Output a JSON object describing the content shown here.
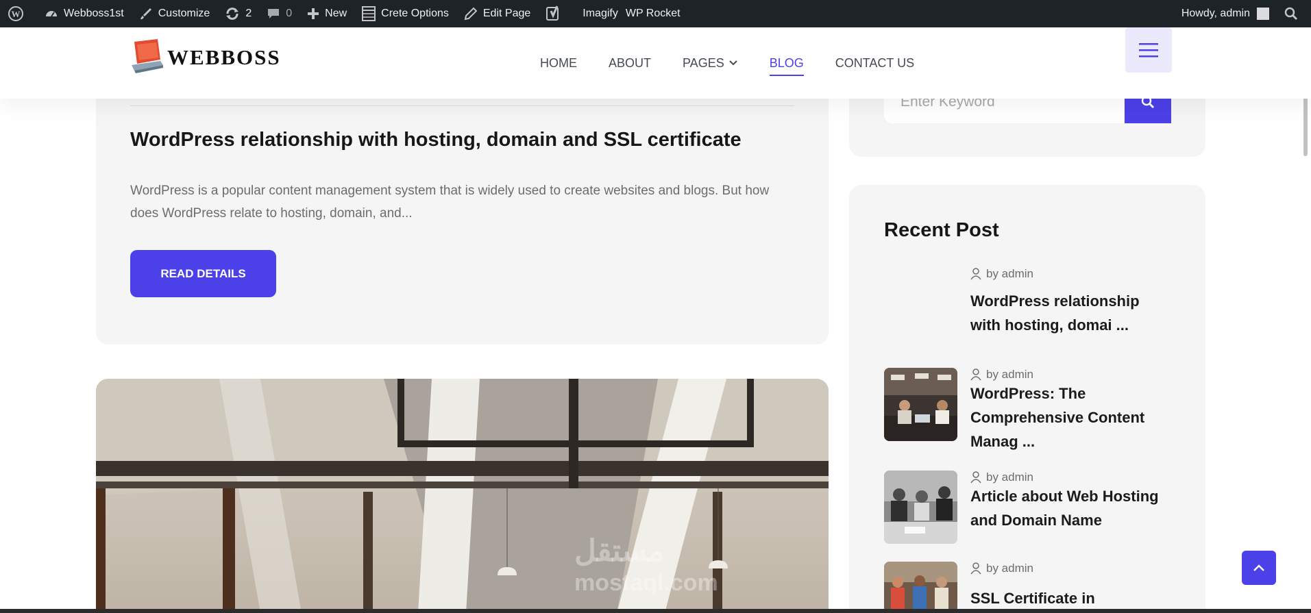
{
  "adminbar": {
    "site_name": "Webboss1st",
    "customize": "Customize",
    "updates_count": "2",
    "comments_count": "0",
    "new_label": "New",
    "crete_options": "Crete Options",
    "edit_page": "Edit Page",
    "imagify": "Imagify",
    "wp_rocket": "WP Rocket",
    "howdy": "Howdy, admin"
  },
  "header": {
    "logo_text": "WEBBOSS",
    "nav": [
      {
        "label": "HOME"
      },
      {
        "label": "ABOUT"
      },
      {
        "label": "PAGES"
      },
      {
        "label": "BLOG"
      },
      {
        "label": "CONTACT US"
      }
    ],
    "active_nav": "BLOG"
  },
  "post": {
    "title": "WordPress relationship with hosting, domain and SSL certificate",
    "excerpt": "WordPress is a popular content management system that is widely used to create websites and blogs. But how does WordPress relate to hosting, domain, and...",
    "button_label": "READ DETAILS"
  },
  "watermark": {
    "line1": "مستقل",
    "line2": "mostaql.com"
  },
  "sidebar": {
    "search_placeholder": "Enter Keyword",
    "recent_title": "Recent Post",
    "recent_posts": [
      {
        "author": "by admin",
        "title": "WordPress relationship with hosting, domai ..."
      },
      {
        "author": "by admin",
        "title": "WordPress: The Comprehensive Content Manag ..."
      },
      {
        "author": "by admin",
        "title": "Article about Web Hosting and Domain Name"
      },
      {
        "author": "by admin",
        "title": "SSL Certificate in"
      }
    ]
  },
  "colors": {
    "accent": "#4c40e8",
    "adminbar": "#1d2327",
    "card": "#f5f5f5"
  }
}
